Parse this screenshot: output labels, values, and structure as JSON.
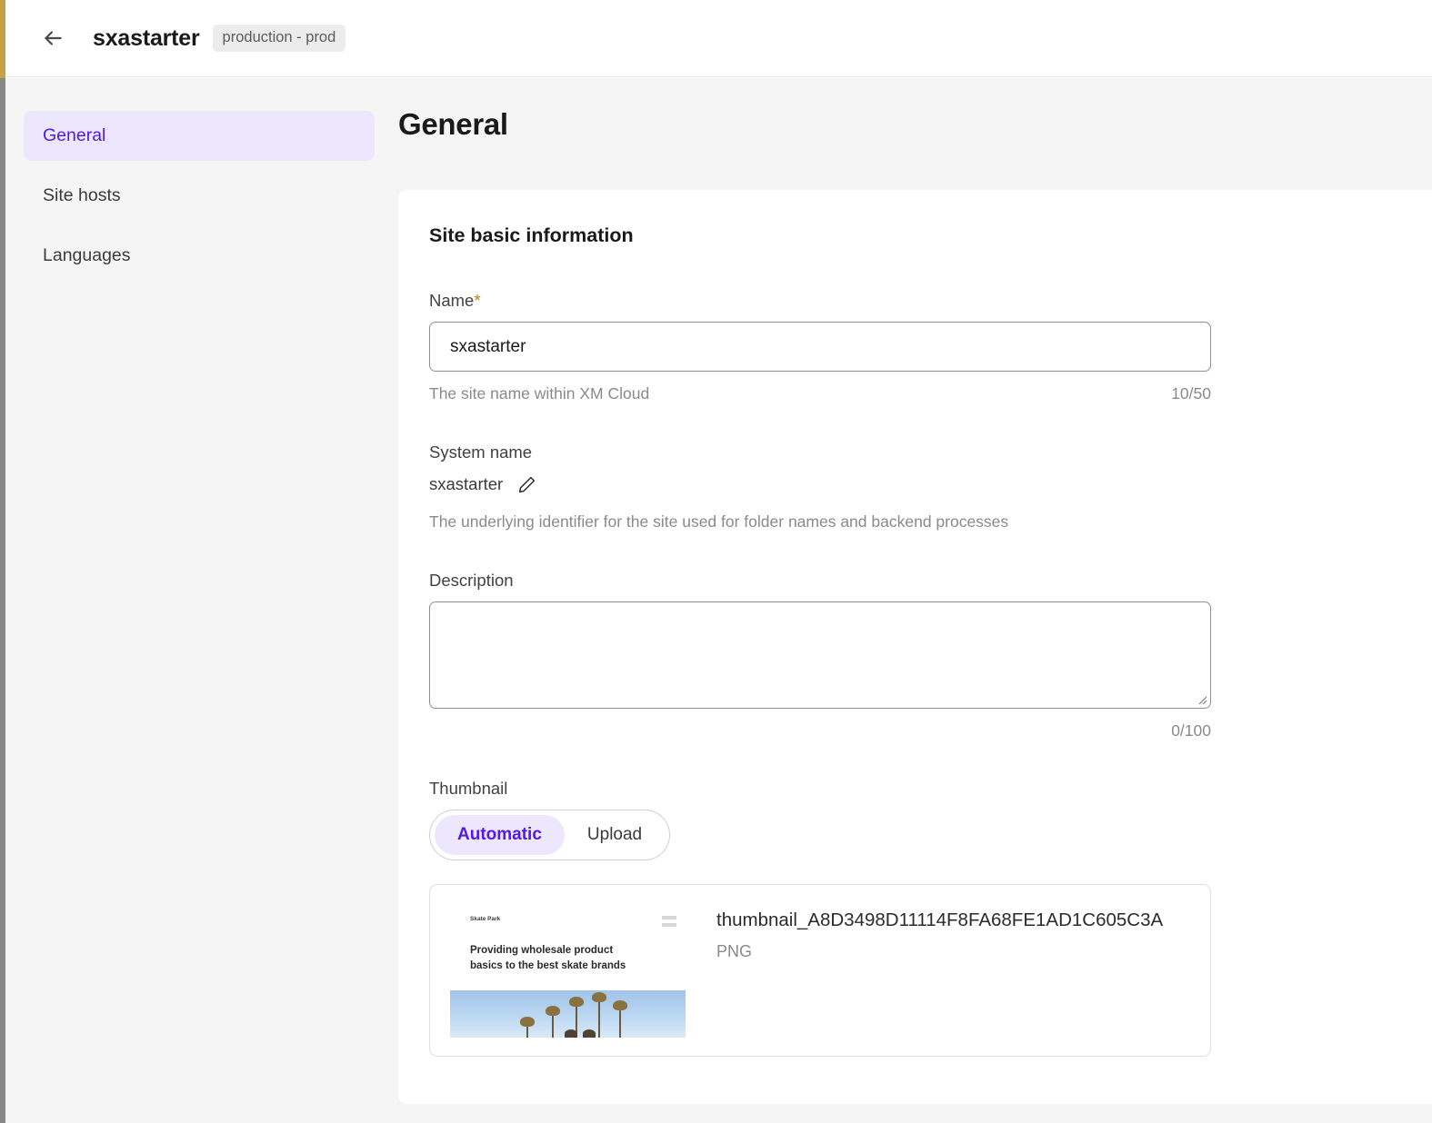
{
  "header": {
    "back_icon": "arrow-left-icon",
    "title": "sxastarter",
    "env_badge": "production - prod"
  },
  "sidebar": {
    "items": [
      {
        "label": "General",
        "active": true
      },
      {
        "label": "Site hosts",
        "active": false
      },
      {
        "label": "Languages",
        "active": false
      }
    ]
  },
  "main": {
    "page_title": "General",
    "card_title": "Site basic information",
    "name_field": {
      "label": "Name",
      "required_marker": "*",
      "value": "sxastarter",
      "placeholder": "",
      "helper": "The site name within XM Cloud",
      "counter": "10/50"
    },
    "system_name_field": {
      "label": "System name",
      "value": "sxastarter",
      "edit_icon": "pencil-icon",
      "helper": "The underlying identifier for the site used for folder names and backend processes"
    },
    "description_field": {
      "label": "Description",
      "value": "",
      "placeholder": "",
      "counter": "0/100"
    },
    "thumbnail_field": {
      "label": "Thumbnail",
      "options": [
        {
          "label": "Automatic",
          "active": true
        },
        {
          "label": "Upload",
          "active": false
        }
      ],
      "preview": {
        "site_logo": "Skate Park",
        "headline": "Providing wholesale product basics to the best skate brands",
        "file_name": "thumbnail_A8D3498D11114F8FA68FE1AD1C605C3A",
        "file_type": "PNG"
      }
    }
  },
  "colors": {
    "accent_purple": "#5319e6",
    "accent_purple_bg": "#ece7fd",
    "required_star": "#b8860b",
    "page_bg": "#f5f5f5",
    "card_bg": "#ffffff",
    "edge_stripe": "#c8a045"
  }
}
